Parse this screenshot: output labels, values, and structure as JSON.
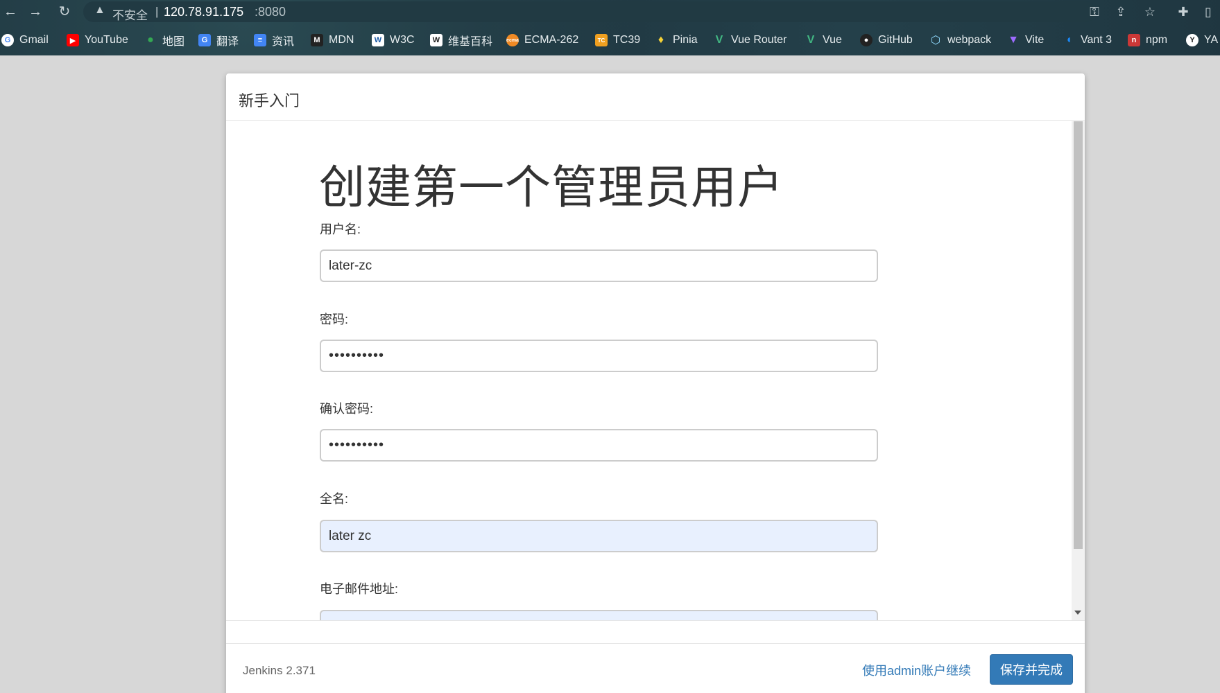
{
  "browser": {
    "security_label": "不安全",
    "separator": "|",
    "host": "120.78.91.175",
    "port": ":8080",
    "bookmarks": [
      {
        "label": "Gmail",
        "icon": "google-icon",
        "color": "#ffffff"
      },
      {
        "label": "YouTube",
        "icon": "youtube-icon",
        "color": "#ff0000"
      },
      {
        "label": "地图",
        "icon": "maps-icon",
        "color": "#34a853"
      },
      {
        "label": "翻译",
        "icon": "translate-icon",
        "color": "#4285f4"
      },
      {
        "label": "资讯",
        "icon": "news-icon",
        "color": "#4285f4"
      },
      {
        "label": "MDN",
        "icon": "mdn-icon",
        "color": "#222222"
      },
      {
        "label": "W3C",
        "icon": "w3c-icon",
        "color": "#1a5aa6"
      },
      {
        "label": "维基百科",
        "icon": "wikipedia-icon",
        "color": "#ffffff"
      },
      {
        "label": "ECMA-262",
        "icon": "ecma-icon",
        "color": "#f08a24"
      },
      {
        "label": "TC39",
        "icon": "tc39-icon",
        "color": "#f0a020"
      },
      {
        "label": "Pinia",
        "icon": "pinia-icon",
        "color": "#f7d336"
      },
      {
        "label": "Vue Router",
        "icon": "vue-icon",
        "color": "#42b883"
      },
      {
        "label": "Vue",
        "icon": "vue-icon",
        "color": "#42b883"
      },
      {
        "label": "GitHub",
        "icon": "github-icon",
        "color": "#222222"
      },
      {
        "label": "webpack",
        "icon": "webpack-icon",
        "color": "#8dd6f9"
      },
      {
        "label": "Vite",
        "icon": "vite-icon",
        "color": "#9d6bff"
      },
      {
        "label": "Vant 3",
        "icon": "vant-icon",
        "color": "#1989fa"
      },
      {
        "label": "npm",
        "icon": "npm-icon",
        "color": "#cb3837"
      },
      {
        "label": "YA",
        "icon": "yapi-icon",
        "color": "#ffffff"
      }
    ]
  },
  "dialog": {
    "header_title": "新手入门",
    "heading": "创建第一个管理员用户",
    "fields": {
      "username": {
        "label": "用户名:",
        "value": "later-zc"
      },
      "password": {
        "label": "密码:",
        "value": "••••••••••"
      },
      "confirm_password": {
        "label": "确认密码:",
        "value": "••••••••••"
      },
      "fullname": {
        "label": "全名:",
        "value": "later zc"
      },
      "email": {
        "label": "电子邮件地址:",
        "value": ""
      }
    },
    "footer": {
      "version": "Jenkins 2.371",
      "continue_admin": "使用admin账户继续",
      "save_finish": "保存并完成"
    }
  }
}
